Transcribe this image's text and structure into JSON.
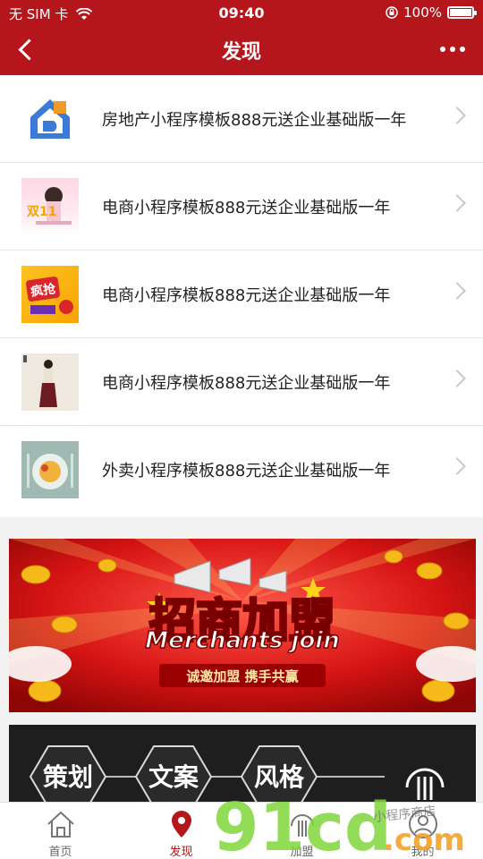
{
  "status": {
    "carrier": "无 SIM 卡",
    "time": "09:40",
    "battery": "100%"
  },
  "nav": {
    "title": "发现"
  },
  "list": [
    {
      "text": "房地产小程序模板888元送企业基础版一年",
      "thumb": "house-logo-icon"
    },
    {
      "text": "电商小程序模板888元送企业基础版一年",
      "thumb": "promo-pink-thumbnail",
      "thumb_text": "双11"
    },
    {
      "text": "电商小程序模板888元送企业基础版一年",
      "thumb": "promo-yellow-thumbnail",
      "thumb_text": "疯抢"
    },
    {
      "text": "电商小程序模板888元送企业基础版一年",
      "thumb": "woman-model-thumbnail"
    },
    {
      "text": "外卖小程序模板888元送企业基础版一年",
      "thumb": "food-plate-thumbnail"
    }
  ],
  "banner1": {
    "title": "招商加盟",
    "subtitle_en": "Merchants join",
    "slogan": "诚邀加盟  携手共赢"
  },
  "banner2": {
    "items": [
      "策划",
      "文案",
      "风格"
    ]
  },
  "tabs": [
    {
      "label": "首页",
      "icon": "home-icon",
      "active": false
    },
    {
      "label": "发现",
      "icon": "location-pin-icon",
      "active": true
    },
    {
      "label": "加盟",
      "icon": "brand-logo-icon",
      "active": false
    },
    {
      "label": "我的",
      "icon": "user-icon",
      "active": false
    }
  ],
  "watermark": {
    "main": "91cd",
    "suffix": ".com",
    "note": "小程序商店"
  },
  "colors": {
    "primary": "#b4161c",
    "tab_active": "#b4161c"
  }
}
